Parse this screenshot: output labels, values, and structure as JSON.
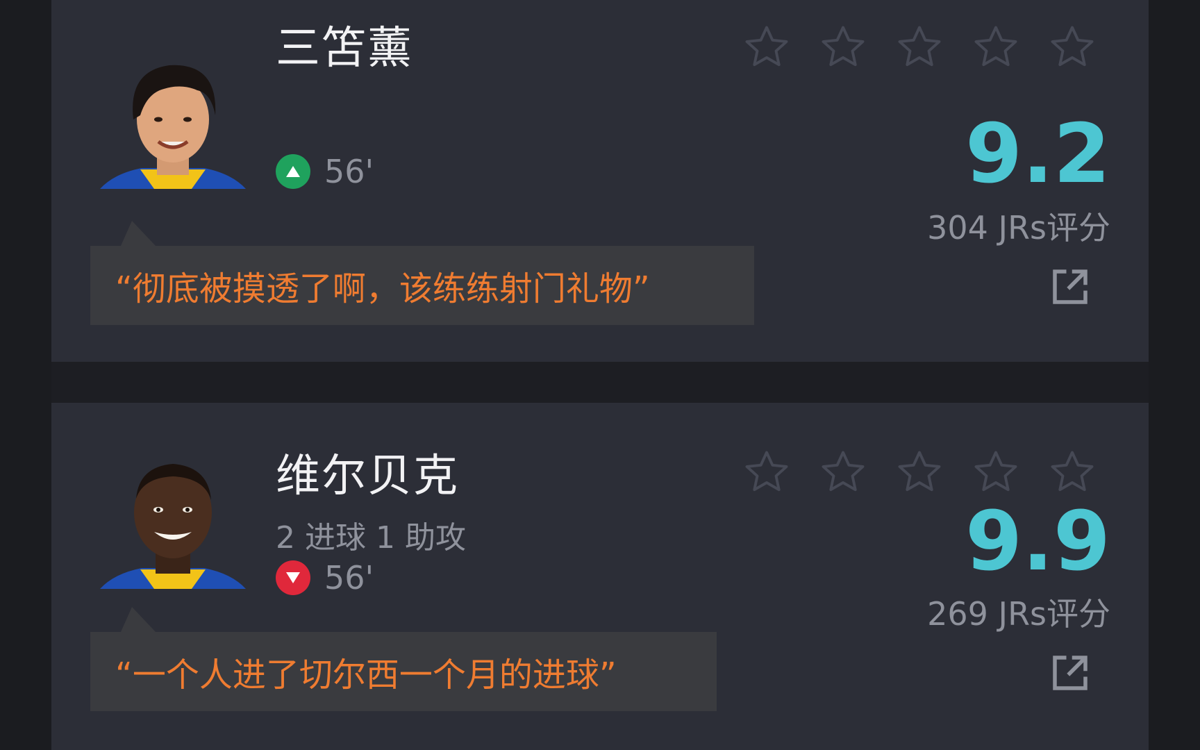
{
  "players": [
    {
      "name": "三笘薰",
      "stats": "",
      "sub_direction": "in",
      "sub_minute": "56'",
      "stars_total": 5,
      "stars_filled": 0,
      "rating": "9.2",
      "votes": "304 JRs评分",
      "comment": "“彻底被摸透了啊，该练练射门礼物”",
      "kit_colors": [
        "#1f4fb4",
        "#f2c318"
      ]
    },
    {
      "name": "维尔贝克",
      "stats": "2 进球  1 助攻",
      "sub_direction": "out",
      "sub_minute": "56'",
      "stars_total": 5,
      "stars_filled": 0,
      "rating": "9.9",
      "votes": "269 JRs评分",
      "comment": "“一个人进了切尔西一个月的进球”",
      "kit_colors": [
        "#1f4fb4",
        "#f2c318"
      ]
    }
  ],
  "colors": {
    "background": "#1d1e23",
    "card": "#2c2e37",
    "rating": "#4dc6d2",
    "comment_text": "#ef7c31",
    "comment_bg": "#3a3b3f",
    "sub_in": "#1fa25d",
    "sub_out": "#e0283b",
    "muted_text": "#8f929c"
  },
  "icons": {
    "sub_in": "triangle-up-icon",
    "sub_out": "triangle-down-icon",
    "star": "star-outline-icon",
    "share": "share-external-icon"
  }
}
